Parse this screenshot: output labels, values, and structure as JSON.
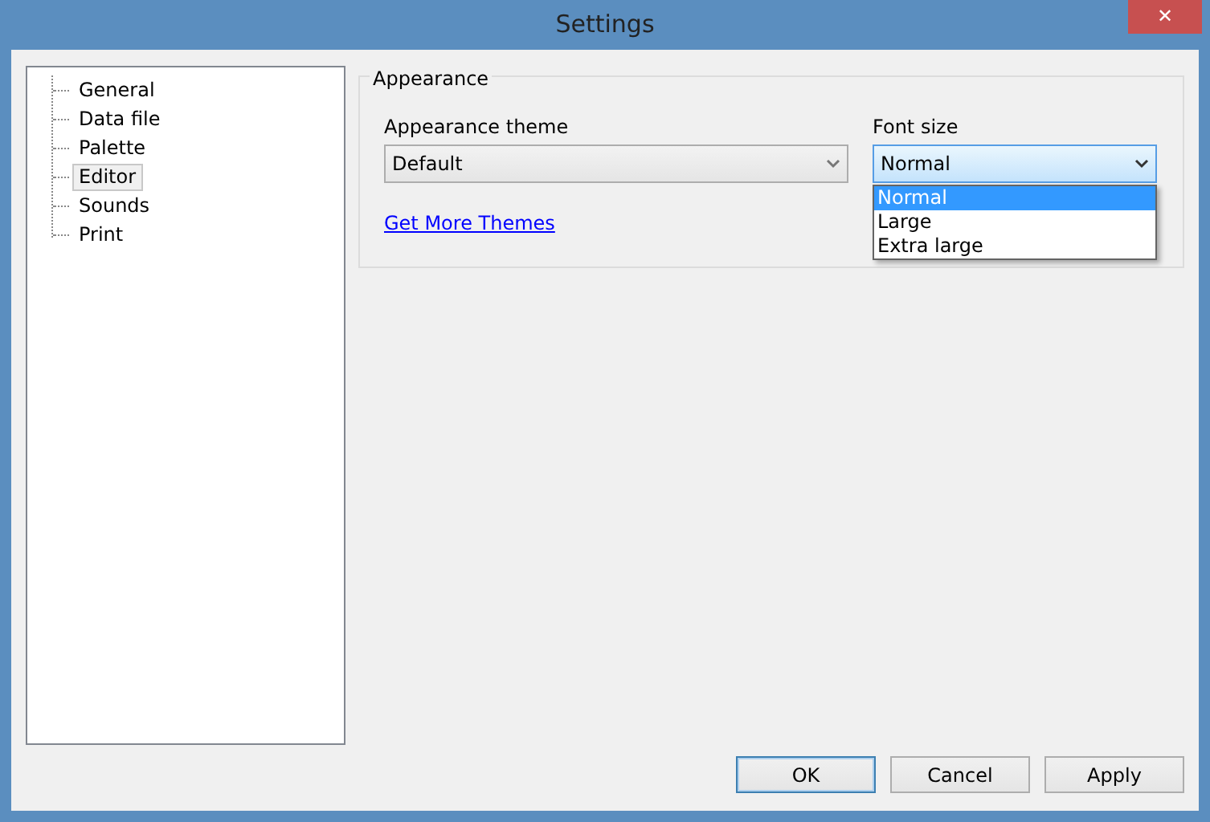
{
  "window": {
    "title": "Settings",
    "close_glyph": "✕"
  },
  "tree": {
    "items": [
      {
        "label": "General",
        "selected": false
      },
      {
        "label": "Data file",
        "selected": false
      },
      {
        "label": "Palette",
        "selected": false
      },
      {
        "label": "Editor",
        "selected": true
      },
      {
        "label": "Sounds",
        "selected": false
      },
      {
        "label": "Print",
        "selected": false
      }
    ]
  },
  "group": {
    "title": "Appearance",
    "theme": {
      "label": "Appearance theme",
      "value": "Default"
    },
    "font_size": {
      "label": "Font size",
      "value": "Normal",
      "expanded": true,
      "options": [
        {
          "label": "Normal",
          "selected": true
        },
        {
          "label": "Large",
          "selected": false
        },
        {
          "label": "Extra large",
          "selected": false
        }
      ]
    },
    "link": "Get More Themes"
  },
  "buttons": [
    {
      "label": "OK",
      "default": true
    },
    {
      "label": "Cancel",
      "default": false
    },
    {
      "label": "Apply",
      "default": false
    }
  ]
}
